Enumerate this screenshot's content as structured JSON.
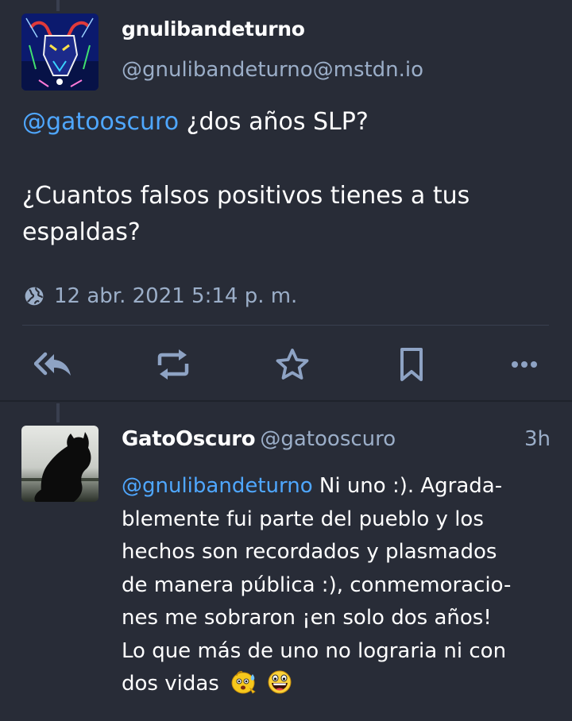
{
  "status": {
    "display_name": "gnulibandeturno",
    "acct": "@gnulibandeturno@mstdn.io",
    "content": {
      "mention": "@gatoosc​uro",
      "line1_rest": " ¿dos años SLP?",
      "paragraph2": "¿Cuantos falsos positivos tienes a tus espaldas?"
    },
    "timestamp": "12 abr. 2021 5:14 p. m.",
    "visibility_icon": "globe-icon",
    "actions": [
      "reply-all-icon",
      "boost-icon",
      "favourite-icon",
      "bookmark-icon",
      "more-icon"
    ]
  },
  "reply": {
    "display_name": "GatoOscuro",
    "acct": "@gatooscuro",
    "relative_time": "3h",
    "content": {
      "mention": "@gnulibandeturno",
      "lines": [
        " Ni uno :). Agrada-",
        "blemente fui parte del pueblo y los",
        "hechos son recordados y plasmados",
        "de manera pública :), conmemoracio-",
        "nes me sobraron ¡en solo dos años!",
        "Lo que más de uno no lograria ni con",
        "dos vidas"
      ],
      "emojis": [
        "sweating-smiley-emoji",
        "laughing-face-emoji"
      ]
    }
  },
  "colors": {
    "background": "#282c37",
    "text": "#ffffff",
    "secondary": "#9baec8",
    "mention": "#4fa7ff",
    "icon": "#8ea3c4"
  }
}
